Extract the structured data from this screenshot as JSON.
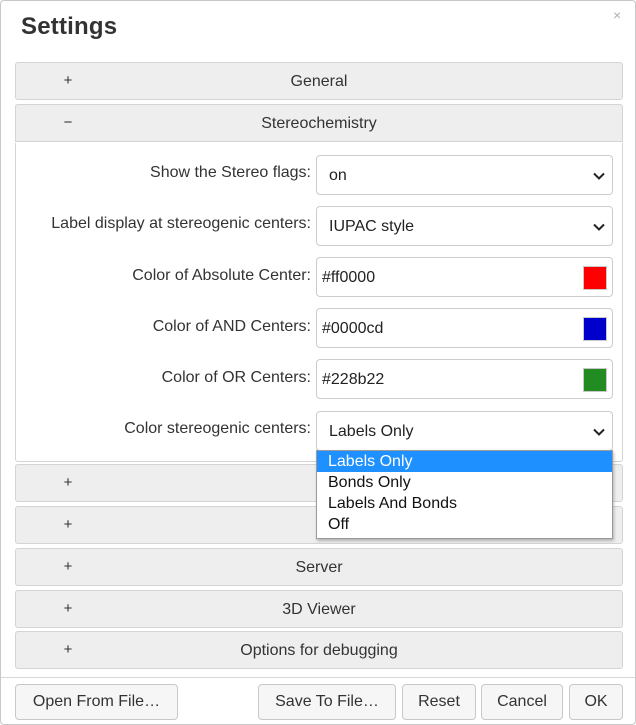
{
  "dialog": {
    "title": "Settings",
    "close_glyph": "×"
  },
  "sections": {
    "general": {
      "label": "General",
      "sign": "+"
    },
    "stereo": {
      "label": "Stereochemistry",
      "sign": "−"
    },
    "hidden1": {
      "label": "",
      "sign": "+"
    },
    "hidden2": {
      "label": "",
      "sign": "+"
    },
    "server": {
      "label": "Server",
      "sign": "+"
    },
    "viewer": {
      "label": "3D Viewer",
      "sign": "+"
    },
    "debug": {
      "label": "Options for debugging",
      "sign": "+"
    }
  },
  "stereo": {
    "show_flags": {
      "label": "Show the Stereo flags:",
      "value": "on"
    },
    "label_display": {
      "label": "Label display at stereogenic centers:",
      "value": "IUPAC style"
    },
    "abs_color": {
      "label": "Color of Absolute Center:",
      "value": "#ff0000",
      "swatch": "#ff0000"
    },
    "and_color": {
      "label": "Color of AND Centers:",
      "value": "#0000cd",
      "swatch": "#0000cd"
    },
    "or_color": {
      "label": "Color of OR Centers:",
      "value": "#228b22",
      "swatch": "#228b22"
    },
    "color_centers": {
      "label": "Color stereogenic centers:",
      "value": "Labels Only",
      "options": [
        "Labels Only",
        "Bonds Only",
        "Labels And Bonds",
        "Off"
      ],
      "highlighted": "Labels Only"
    }
  },
  "footer": {
    "open_label": "Open From File…",
    "save_label": "Save To File…",
    "reset_label": "Reset",
    "cancel_label": "Cancel",
    "ok_label": "OK"
  },
  "icons": {
    "chevron": "chevron-down-icon",
    "close": "close-icon"
  },
  "colors": {
    "highlight": "#1e90ff",
    "header_bg": "#eeeeee"
  }
}
